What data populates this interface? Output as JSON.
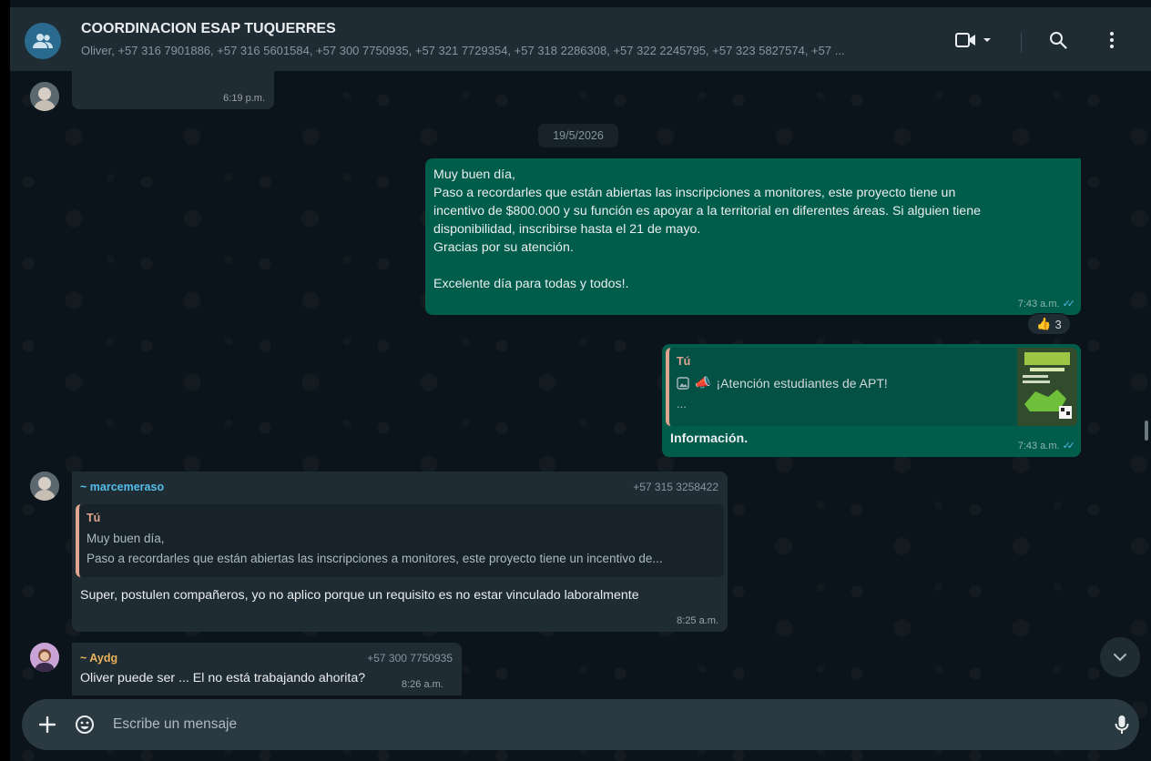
{
  "header": {
    "title": "COORDINACION ESAP TUQUERRES",
    "subtitle": "Oliver, +57 316 7901886, +57 316 5601584, +57 300 7750935, +57 321 7729354, +57 318 2286308, +57 322 2245795, +57 323 5827574, +57 ...",
    "icons": [
      "group-icon",
      "video-call-icon",
      "chevron-down-icon",
      "search-icon",
      "menu-icon"
    ]
  },
  "messages": {
    "first": {
      "time": "6:19 p.m."
    },
    "date_separator": "19/5/2026",
    "announcement": {
      "lines": [
        "Muy buen día,",
        "Paso a recordarles que están abiertas las inscripciones a monitores,  este proyecto tiene un",
        "incentivo de $800.000 y su función es apoyar a la territorial en diferentes áreas. Si alguien tiene",
        "disponibilidad, inscribirse hasta el 21 de mayo.",
        "Gracias por su atención.",
        "",
        "Excelente día para todas y todos!."
      ],
      "time": "7:43 a.m.",
      "reaction_emoji": "👍",
      "reaction_count": "3"
    },
    "info_reply": {
      "quote_author": "Tú",
      "quote_text": "¡Atención estudiantes de APT!",
      "quote_more": "...",
      "body": "Información.",
      "time": "7:43 a.m."
    },
    "marcemeraso": {
      "sender": "~ marcemeraso",
      "phone": "+57 315 3258422",
      "quote_author": "Tú",
      "quote_line1": "Muy buen día,",
      "quote_line2": "Paso a recordarles que están abiertas las inscripciones a monitores,  este proyecto tiene un incentivo de...",
      "body": "Super, postulen compañeros,   yo no aplico porque un requisito es no estar vinculado laboralmente",
      "time": "8:25 a.m."
    },
    "aydg": {
      "sender": "~ Aydg",
      "phone": "+57 300 7750935",
      "body": "Oliver puede ser ... El no está trabajando ahorita?",
      "time": "8:26 a.m."
    }
  },
  "composer": {
    "placeholder": "Escribe un mensaje",
    "icons": [
      "plus-icon",
      "emoji-icon",
      "microphone-icon"
    ]
  },
  "colors": {
    "background": "#0b141a",
    "header": "#202c33",
    "incoming": "#202c33",
    "outgoing": "#005c4b",
    "marcemeraso_name": "#53bdeb",
    "aydg_name": "#e9b35b",
    "quote_author": "#e0a58e"
  }
}
